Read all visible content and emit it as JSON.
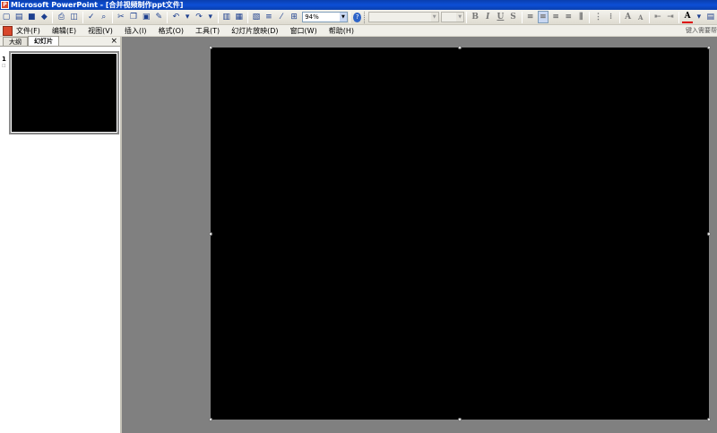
{
  "window": {
    "title": "Microsoft PowerPoint - [合并视频制作ppt文件]"
  },
  "toolbar": {
    "zoom": "94%",
    "zoom_options": [
      "94%"
    ]
  },
  "menu": {
    "items": [
      "文件(F)",
      "编辑(E)",
      "视图(V)",
      "插入(I)",
      "格式(O)",
      "工具(T)",
      "幻灯片放映(D)",
      "窗口(W)",
      "帮助(H)"
    ],
    "help_placeholder": "键入需要帮"
  },
  "left_pane": {
    "tabs": [
      "大纲",
      "幻灯片"
    ],
    "active_tab": "幻灯片",
    "close_glyph": "×",
    "slide_number": "1",
    "slide_note": "☐"
  },
  "slide": {
    "background": "#000000"
  },
  "colors": {
    "titlebar": "#0c4fd6",
    "app_accent": "#d8472b",
    "workspace": "#808080"
  },
  "icons": [
    "new-icon",
    "open-icon",
    "save-icon",
    "permission-icon",
    "print-icon",
    "print-preview-icon",
    "spelling-icon",
    "research-icon",
    "cut-icon",
    "copy-icon",
    "paste-icon",
    "format-painter-icon",
    "undo-icon",
    "redo-icon",
    "insert-chart-icon",
    "insert-table-icon",
    "tables-borders-icon",
    "expand-all-icon",
    "show-formatting-icon",
    "grid-icon",
    "help-icon",
    "bold-icon",
    "italic-icon",
    "underline-icon",
    "shadow-icon",
    "align-left-icon",
    "center-icon",
    "align-right-icon",
    "numbering-icon",
    "bullets-icon",
    "increase-font-icon",
    "decrease-font-icon",
    "font-color-icon",
    "design-icon"
  ]
}
